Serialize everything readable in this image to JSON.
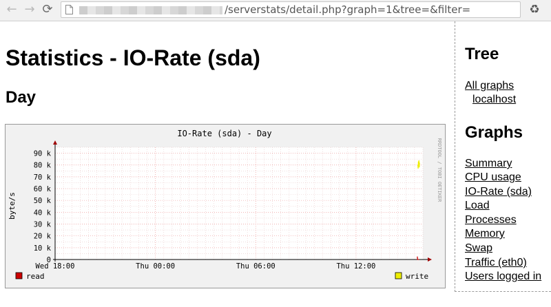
{
  "browser": {
    "url_path": "/serverstats/detail.php?graph=1&tree=&filter=",
    "icons": {
      "back": "arrow-left-icon",
      "forward": "arrow-right-icon",
      "reload": "reload-icon",
      "page": "page-icon",
      "extension": "recycle-icon"
    }
  },
  "page": {
    "title": "Statistics - IO-Rate (sda)",
    "section": "Day"
  },
  "sidebar": {
    "tree_heading": "Tree",
    "tree_items": [
      {
        "label": "All graphs"
      },
      {
        "label": "localhost"
      }
    ],
    "graphs_heading": "Graphs",
    "graph_items": [
      {
        "label": "Summary"
      },
      {
        "label": "CPU usage"
      },
      {
        "label": "IO-Rate (sda)"
      },
      {
        "label": "Load"
      },
      {
        "label": "Processes"
      },
      {
        "label": "Memory"
      },
      {
        "label": "Swap"
      },
      {
        "label": "Traffic (eth0)"
      },
      {
        "label": "Users logged in"
      }
    ]
  },
  "chart_data": {
    "type": "line",
    "title": "IO-Rate (sda) - Day",
    "ylabel": "byte/s",
    "watermark": "RRDTOOL / TOBI OETIKER",
    "ylim": [
      0,
      95000
    ],
    "y_ticks": [
      {
        "value": 0,
        "label": "0"
      },
      {
        "value": 10000,
        "label": "10 k"
      },
      {
        "value": 20000,
        "label": "20 k"
      },
      {
        "value": 30000,
        "label": "30 k"
      },
      {
        "value": 40000,
        "label": "40 k"
      },
      {
        "value": 50000,
        "label": "50 k"
      },
      {
        "value": 60000,
        "label": "60 k"
      },
      {
        "value": 70000,
        "label": "70 k"
      },
      {
        "value": 80000,
        "label": "80 k"
      },
      {
        "value": 90000,
        "label": "90 k"
      }
    ],
    "xlim": [
      0,
      1320
    ],
    "x_ticks": [
      {
        "value": 0,
        "label": "Wed 18:00"
      },
      {
        "value": 360,
        "label": "Thu 00:00"
      },
      {
        "value": 720,
        "label": "Thu 06:00"
      },
      {
        "value": 1080,
        "label": "Thu 12:00"
      }
    ],
    "series": [
      {
        "name": "read",
        "color": "#cc0000",
        "points": [
          [
            1300,
            2500
          ],
          [
            1301,
            0
          ],
          [
            1306,
            0
          ]
        ]
      },
      {
        "name": "write",
        "color": "#eeee00",
        "points": [
          [
            1302,
            80000
          ],
          [
            1303,
            77000
          ],
          [
            1304,
            83000
          ],
          [
            1305,
            79000
          ],
          [
            1306,
            84000
          ],
          [
            1307,
            78000
          ],
          [
            1308,
            82000
          ]
        ]
      }
    ]
  }
}
